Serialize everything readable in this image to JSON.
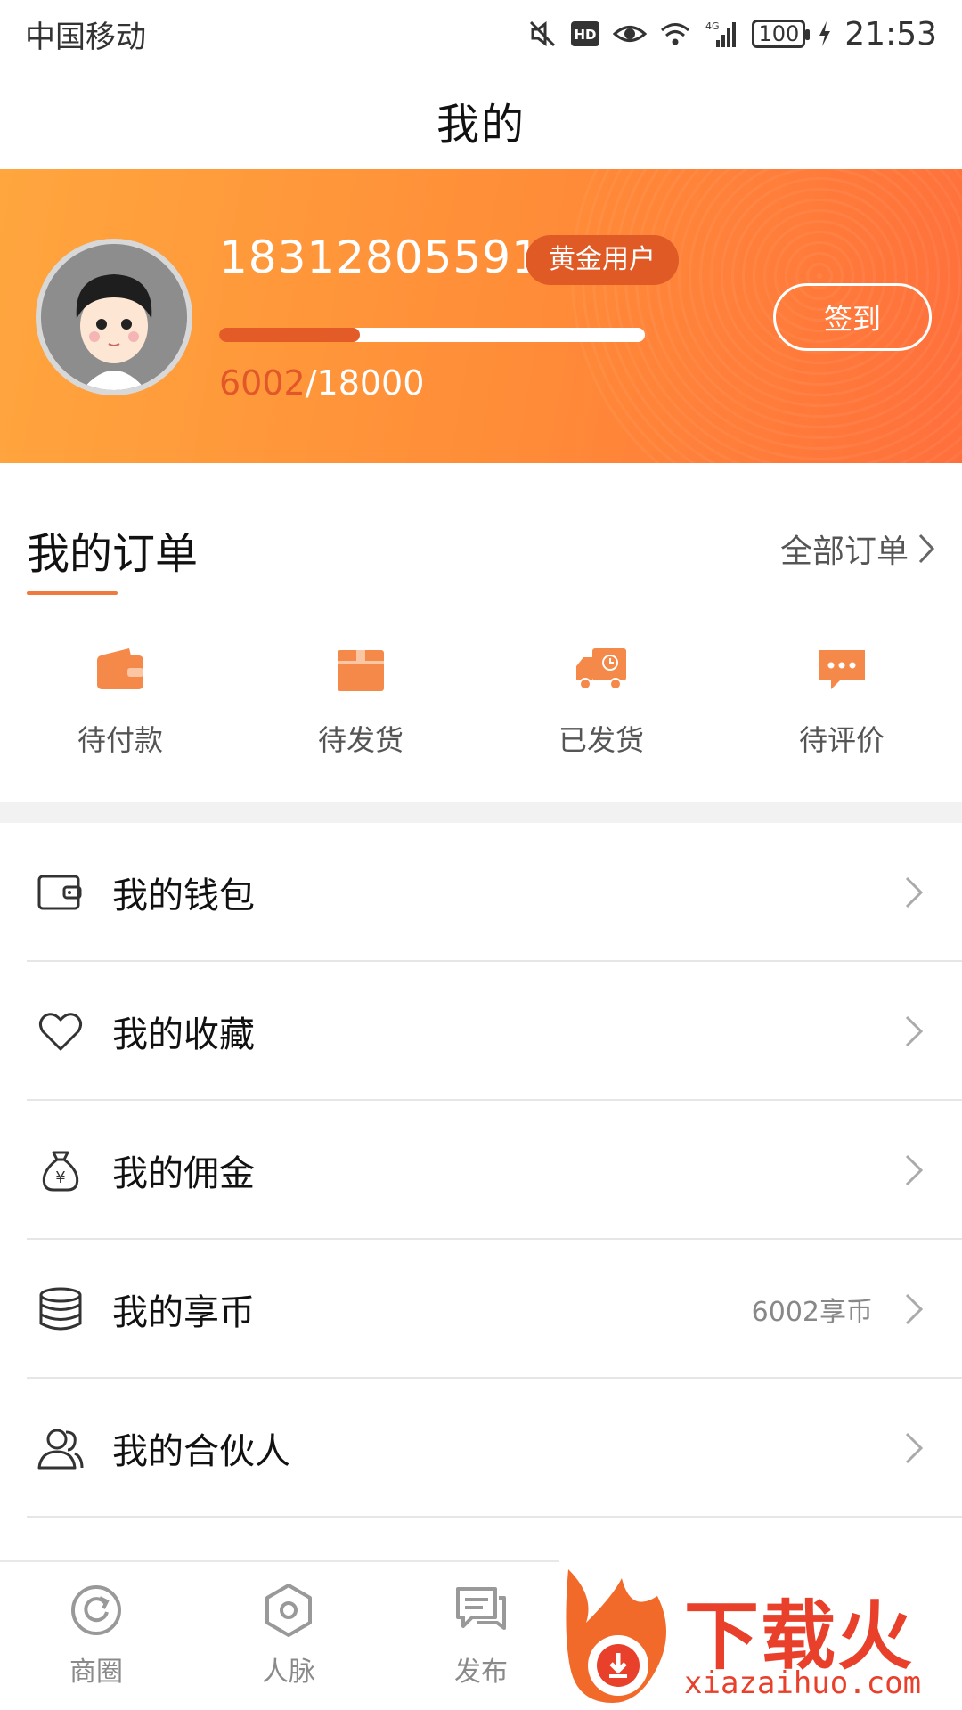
{
  "status_bar": {
    "carrier": "中国移动",
    "network": "4G",
    "battery": "100",
    "time": "21:53"
  },
  "header": {
    "title": "我的"
  },
  "profile": {
    "phone": "18312805591",
    "level": "黄金用户",
    "progress_current": "6002",
    "progress_total": "/18000",
    "progress_fraction": 0.33,
    "checkin_label": "签到"
  },
  "orders": {
    "title": "我的订单",
    "all_label": "全部订单",
    "items": [
      {
        "label": "待付款",
        "icon": "wallet-icon"
      },
      {
        "label": "待发货",
        "icon": "box-icon"
      },
      {
        "label": "已发货",
        "icon": "truck-icon"
      },
      {
        "label": "待评价",
        "icon": "comment-icon"
      }
    ]
  },
  "menu": [
    {
      "label": "我的钱包",
      "value": "",
      "icon": "wallet-outline-icon"
    },
    {
      "label": "我的收藏",
      "value": "",
      "icon": "heart-icon"
    },
    {
      "label": "我的佣金",
      "value": "",
      "icon": "money-bag-icon"
    },
    {
      "label": "我的享币",
      "value": "6002享币",
      "icon": "coin-stack-icon"
    },
    {
      "label": "我的合伙人",
      "value": "",
      "icon": "partners-icon"
    }
  ],
  "bottom_nav": [
    {
      "label": "商圈",
      "icon": "circle-refresh-icon"
    },
    {
      "label": "人脉",
      "icon": "hexagon-icon"
    },
    {
      "label": "发布",
      "icon": "publish-icon"
    }
  ],
  "watermark": {
    "title": "下载火",
    "url": "xiazaihuo.com"
  },
  "colors": {
    "accent": "#ff8c38",
    "badge": "#e05a26",
    "order_icon": "#f5894a"
  }
}
